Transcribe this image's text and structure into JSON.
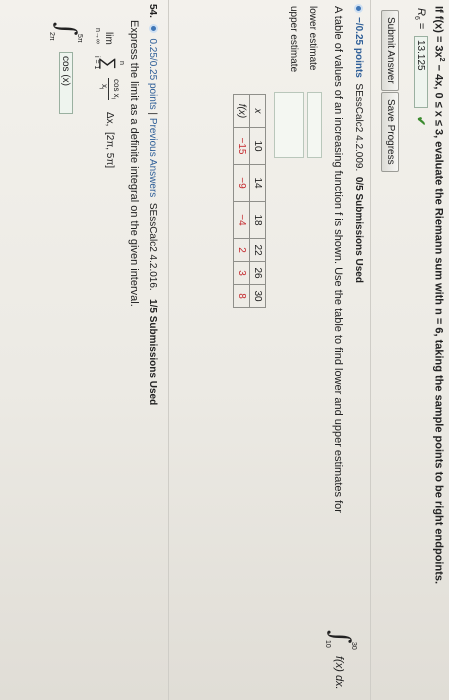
{
  "q1": {
    "line1_prefix": "If f(x) = 3x",
    "line1_sup": "2",
    "line1_rest": " − 4x, 0 ≤ x ≤ 3, evaluate the Riemann sum with n = 6, taking the sample points to be right endpoints.",
    "r6_label": "R",
    "r6_sub": "6",
    "r6_eq": " =",
    "r6_value": "13.125",
    "submit_label": "Submit Answer",
    "save_label": "Save Progress"
  },
  "q2": {
    "points": "−/0.25 points",
    "code": "SEssCalc2 4.2.009.",
    "submissions": "0/5 Submissions Used",
    "prompt": "A table of values of an increasing function f is shown. Use the table to find lower and upper estimates for",
    "integral_upper": "30",
    "integral_lower": "10",
    "integrand": "f(x) dx.",
    "lower_label": "lower estimate",
    "upper_label": "upper estimate",
    "table": {
      "x_label": "x",
      "fx_label": "f(x)",
      "x_values": [
        "10",
        "14",
        "18",
        "22",
        "26",
        "30"
      ],
      "f_values": [
        "−15",
        "−9",
        "−4",
        "2",
        "3",
        "8"
      ]
    }
  },
  "q3": {
    "number": "54.",
    "points": "0.25/0.25 points",
    "separator": "|",
    "previous": "Previous Answers",
    "code": "SEssCalc2 4.2.016.",
    "submissions": "1/5 Submissions Used",
    "prompt": "Express the limit as a definite integral on the given interval.",
    "lim_label": "lim",
    "lim_under": "n→∞",
    "sum_top": "n",
    "sum_bottom": "i = 1",
    "fraction_top": "cos x",
    "fraction_bottom": "x",
    "term_sub": "i",
    "delta": "Δx,",
    "interval": "[2π, 5π]",
    "answer_upper": "5π",
    "answer_lower": "2π",
    "answer_text": "cos (x)"
  }
}
